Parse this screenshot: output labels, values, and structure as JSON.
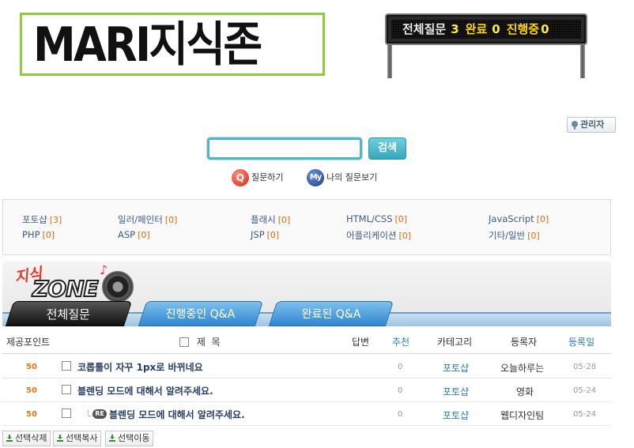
{
  "logo": {
    "text": "MARI지식존"
  },
  "board": {
    "total_label": "전체질문",
    "total": "3",
    "done_label": "완료",
    "done": "0",
    "progress_label": "진행중",
    "progress": "0"
  },
  "admin": {
    "label": "관리자"
  },
  "search": {
    "value": "",
    "button": "검색"
  },
  "links": {
    "ask": "질문하기",
    "ask_badge": "Q",
    "mine": "나의 질문보기",
    "mine_badge": "My"
  },
  "categories": [
    {
      "name": "포토샵",
      "count": "[3]"
    },
    {
      "name": "일러/페인터",
      "count": "[0]"
    },
    {
      "name": "플래시",
      "count": "[0]"
    },
    {
      "name": "HTML/CSS",
      "count": "[0]"
    },
    {
      "name": "JavaScript",
      "count": "[0]"
    },
    {
      "name": "PHP",
      "count": "[0]"
    },
    {
      "name": "ASP",
      "count": "[0]"
    },
    {
      "name": "JSP",
      "count": "[0]"
    },
    {
      "name": "어플리케이션",
      "count": "[0]"
    },
    {
      "name": "기타/일반",
      "count": "[0]"
    }
  ],
  "zone": {
    "jisik": "지식",
    "word": "ZONE"
  },
  "tabs": {
    "all": "전체질문",
    "progress": "진행중인 Q&A",
    "done": "완료된 Q&A"
  },
  "columns": {
    "points": "제공포인트",
    "title": "제  목",
    "answers": "답변",
    "recommend": "추천",
    "category": "카테고리",
    "author": "등록자",
    "date": "등록일"
  },
  "rows": [
    {
      "points": "50",
      "title": "코롭툴이 자꾸 1px로 바뀌네요",
      "recommend": "0",
      "category": "포토샵",
      "author": "오늘하루는",
      "date": "05-28"
    },
    {
      "points": "50",
      "title": "블렌딩 모드에 대해서 알려주세요.",
      "recommend": "0",
      "category": "포토샵",
      "author": "영화",
      "date": "05-24"
    },
    {
      "points": "50",
      "title": "블렌딩 모드에 대해서 알려주세요.",
      "recommend": "0",
      "category": "포토샵",
      "author": "웹디자인팀",
      "date": "05-24",
      "reply_badge": "RE"
    }
  ],
  "actions": {
    "delete": "선택삭제",
    "copy": "선택복사",
    "move": "선택이동"
  }
}
